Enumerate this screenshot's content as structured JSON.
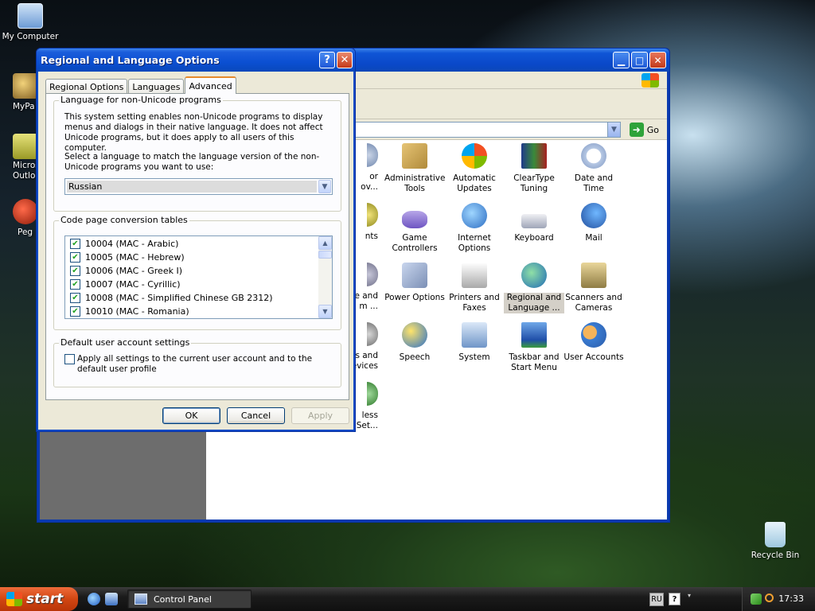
{
  "desktop": {
    "icons": [
      {
        "label": "My Computer"
      },
      {
        "label": "MyPa"
      },
      {
        "label": "Micros\nOutlo"
      },
      {
        "label": "Peg"
      },
      {
        "label": "Recycle Bin"
      }
    ]
  },
  "control_panel": {
    "go_label": "Go",
    "items": [
      {
        "label": "Administrative Tools",
        "icon": "administrative-tools-icon"
      },
      {
        "label": "Automatic Updates",
        "icon": "automatic-updates-icon"
      },
      {
        "label": "ClearType Tuning",
        "icon": "cleartype-icon"
      },
      {
        "label": "Date and Time",
        "icon": "date-time-icon"
      },
      {
        "label": "Game Controllers",
        "icon": "game-controllers-icon"
      },
      {
        "label": "Internet Options",
        "icon": "internet-options-icon"
      },
      {
        "label": "Keyboard",
        "icon": "keyboard-icon"
      },
      {
        "label": "Mail",
        "icon": "mail-icon"
      },
      {
        "label": "Power Options",
        "icon": "power-options-icon"
      },
      {
        "label": "Printers and Faxes",
        "icon": "printers-faxes-icon"
      },
      {
        "label": "Regional and Language ...",
        "icon": "regional-language-icon"
      },
      {
        "label": "Scanners and Cameras",
        "icon": "scanners-cameras-icon"
      },
      {
        "label": "Speech",
        "icon": "speech-icon"
      },
      {
        "label": "System",
        "icon": "system-icon"
      },
      {
        "label": "Taskbar and Start Menu",
        "icon": "taskbar-startmenu-icon"
      },
      {
        "label": "User Accounts",
        "icon": "user-accounts-icon"
      }
    ],
    "partial_items": [
      {
        "label": "or\nov..."
      },
      {
        "label": "nts"
      },
      {
        "label": "e and\nm ..."
      },
      {
        "label": "s and\nevices"
      },
      {
        "label": "less\nk Set..."
      }
    ]
  },
  "dialog": {
    "title": "Regional and Language Options",
    "help_glyph": "?",
    "close_glyph": "✕",
    "tabs": [
      "Regional Options",
      "Languages",
      "Advanced"
    ],
    "active_tab": "Advanced",
    "non_unicode": {
      "group_label": "Language for non-Unicode programs",
      "description": "This system setting enables non-Unicode programs to display menus and dialogs in their native language. It does not affect Unicode programs, but it does apply to all users of this computer.",
      "select_prompt": "Select a language to match the language version of the non-Unicode programs you want to use:",
      "selected_language": "Russian"
    },
    "code_page": {
      "group_label": "Code page conversion tables",
      "entries": [
        {
          "label": "10004 (MAC - Arabic)",
          "checked": true
        },
        {
          "label": "10005 (MAC - Hebrew)",
          "checked": true
        },
        {
          "label": "10006 (MAC - Greek I)",
          "checked": true
        },
        {
          "label": "10007 (MAC - Cyrillic)",
          "checked": true
        },
        {
          "label": "10008 (MAC - Simplified Chinese GB 2312)",
          "checked": true
        },
        {
          "label": "10010 (MAC - Romania)",
          "checked": true
        }
      ]
    },
    "default_user": {
      "group_label": "Default user account settings",
      "checkbox_label": "Apply all settings to the current user account and to the default user profile",
      "checked": false
    },
    "buttons": {
      "ok": "OK",
      "cancel": "Cancel",
      "apply": "Apply"
    }
  },
  "taskbar": {
    "start_label": "start",
    "task_label": "Control Panel",
    "language": "RU",
    "help_glyph": "?",
    "clock": "17:33"
  }
}
